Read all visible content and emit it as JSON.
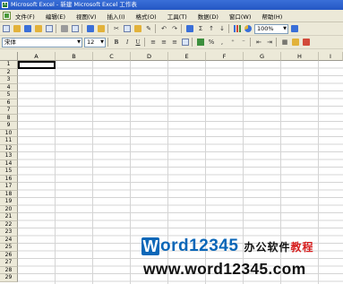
{
  "window": {
    "title": "Microsoft Excel - 新建 Microsoft Excel 工作表"
  },
  "menubar": {
    "items": [
      {
        "label": "文件(F)"
      },
      {
        "label": "编辑(E)"
      },
      {
        "label": "视图(V)"
      },
      {
        "label": "插入(I)"
      },
      {
        "label": "格式(O)"
      },
      {
        "label": "工具(T)"
      },
      {
        "label": "数据(D)"
      },
      {
        "label": "窗口(W)"
      },
      {
        "label": "帮助(H)"
      }
    ]
  },
  "standard_toolbar": {
    "autosum_label": "Σ",
    "zoom_value": "100%"
  },
  "format_toolbar": {
    "font_name": "宋体",
    "font_size": "12",
    "bold_label": "B",
    "italic_label": "I",
    "underline_label": "U",
    "percent_label": "%",
    "comma_label": ","
  },
  "sheet": {
    "columns": [
      "A",
      "B",
      "C",
      "D",
      "E",
      "F",
      "G",
      "H",
      "I"
    ],
    "rows": [
      "1",
      "2",
      "3",
      "4",
      "5",
      "6",
      "7",
      "8",
      "9",
      "10",
      "11",
      "12",
      "13",
      "14",
      "15",
      "16",
      "17",
      "18",
      "19",
      "20",
      "21",
      "22",
      "23",
      "24",
      "25",
      "26",
      "27",
      "28",
      "29"
    ]
  },
  "watermark": {
    "logo_letter": "W",
    "logo_text": "ord12345",
    "cn_text_black": "办公软件",
    "cn_text_red": "教程",
    "url": "www.word12345.com"
  }
}
